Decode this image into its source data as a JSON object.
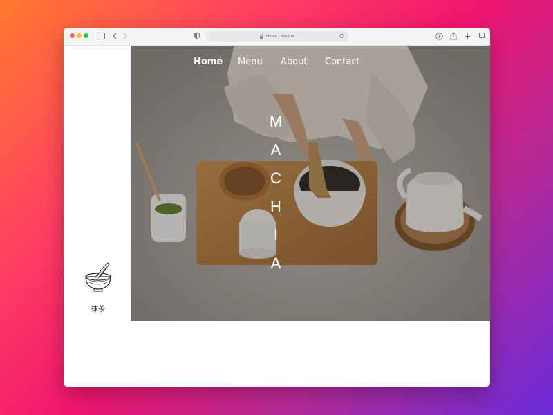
{
  "browser": {
    "url": "Home | Machia"
  },
  "nav": {
    "items": [
      {
        "label": "Home",
        "active": true
      },
      {
        "label": "Menu",
        "active": false
      },
      {
        "label": "About",
        "active": false
      },
      {
        "label": "Contact",
        "active": false
      }
    ]
  },
  "hero": {
    "brand_letters": [
      "M",
      "A",
      "C",
      "H",
      "I",
      "A"
    ]
  },
  "logo": {
    "label": "抹茶",
    "icon": "matcha-bowl-whisk-icon"
  },
  "colors": {
    "background_gradient": [
      "#ff7a2e",
      "#f0166f",
      "#6a2bd9"
    ],
    "nav_text": "#ffffff",
    "window_bg": "#ffffff"
  }
}
